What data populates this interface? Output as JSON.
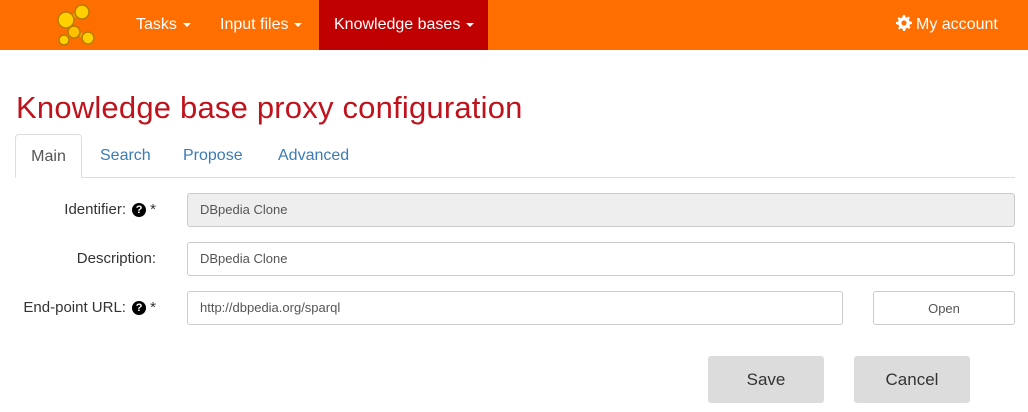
{
  "navbar": {
    "logo_icon": "molecule-logo",
    "items": [
      {
        "label": "Tasks"
      },
      {
        "label": "Input files"
      },
      {
        "label": "Knowledge bases"
      }
    ],
    "account_label": "My account",
    "account_icon": "gear-icon",
    "colors": {
      "background": "#ff6e00",
      "active": "#c00000"
    }
  },
  "page": {
    "title": "Knowledge base proxy configuration",
    "title_color": "#c0121c"
  },
  "tabs": [
    {
      "label": "Main",
      "active": true
    },
    {
      "label": "Search",
      "active": false
    },
    {
      "label": "Propose",
      "active": false
    },
    {
      "label": "Advanced",
      "active": false
    }
  ],
  "form": {
    "identifier": {
      "label": "Identifier:",
      "required": "*",
      "value": "DBpedia Clone",
      "help_icon": "question-circle-icon"
    },
    "description": {
      "label": "Description:",
      "value": "DBpedia Clone"
    },
    "endpoint": {
      "label": "End-point URL:",
      "required": "*",
      "value": "http://dbpedia.org/sparql",
      "help_icon": "question-circle-icon",
      "open_label": "Open"
    }
  },
  "actions": {
    "save_label": "Save",
    "cancel_label": "Cancel"
  }
}
